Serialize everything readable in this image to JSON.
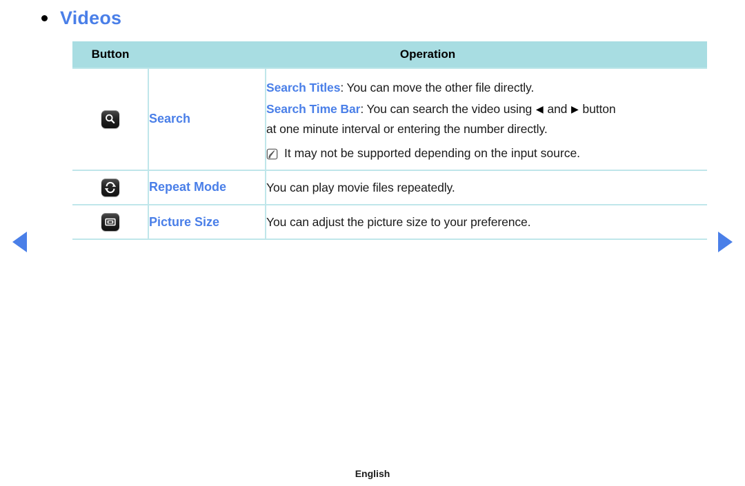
{
  "page": {
    "title": "Videos",
    "bullet_icon": "bullet-dot",
    "footer_label": "English"
  },
  "nav": {
    "prev_icon": "triangle-left-icon",
    "next_icon": "triangle-right-icon",
    "prev_label": "Previous page",
    "next_label": "Next page",
    "arrow_color": "#4a7fe8"
  },
  "table": {
    "header": {
      "button": "Button",
      "operation": "Operation",
      "background": "#a8dde2",
      "border_color": "#bfe6ea"
    },
    "rows": [
      {
        "icon": "search-key-icon",
        "name": "Search",
        "lines": [
          {
            "key": "Search Titles",
            "sep": ": ",
            "text": "You can move the other file directly."
          },
          {
            "key": "Search Time Bar",
            "sep": ": ",
            "text": "You can search the video using ◀ and ▶ button at one minute interval or entering the number directly.",
            "text_before_arrows": "You can search the video using ",
            "text_between_arrows": " and ",
            "text_after_arrows": " button",
            "text_line2": "at one minute interval or entering the number directly."
          }
        ],
        "note": {
          "icon": "note-icon",
          "text": "It may not be supported depending on the input source."
        }
      },
      {
        "icon": "repeat-key-icon",
        "name": "Repeat Mode",
        "lines": [
          {
            "key": "",
            "sep": "",
            "text": "You can play movie files repeatedly."
          }
        ]
      },
      {
        "icon": "picture-size-key-icon",
        "name": "Picture Size",
        "lines": [
          {
            "key": "",
            "sep": "",
            "text": "You can adjust the picture size to your preference."
          }
        ]
      }
    ]
  },
  "colors": {
    "accent_blue": "#4a7fe8",
    "header_cyan": "#a8dde2",
    "border_cyan": "#bfe6ea",
    "text_black": "#1a1a1a"
  }
}
